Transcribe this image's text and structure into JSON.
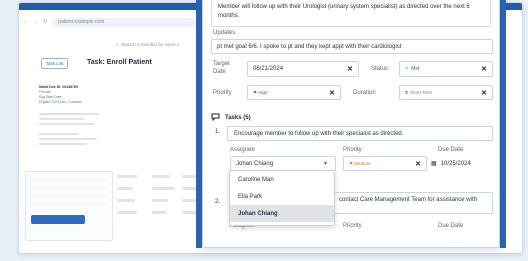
{
  "background": {
    "url_text": "patient.example.com",
    "search_placeholder": "Search a member by name o",
    "back_label": "Task List",
    "page_title": "Task: Enroll Patient",
    "member_info": [
      "Maria Doe ID: 00448765",
      "Female",
      "Elig Start Date",
      "Eligible 2024 Dec. Contract"
    ]
  },
  "panel": {
    "note_text": "Member will follow up with their Urologist (urinary system specialist) as directed over the next 6 months.",
    "updates_label": "Updates",
    "updates_value": "pt met goal 6/6. I spoke to pt and they kept appt with their cardiologist",
    "target_date_label": "Target Date",
    "target_date_value": "06/21/2024",
    "status_label": "Status",
    "status_value": "Met",
    "priority_label": "Priority",
    "priority_value": "High",
    "duration_label": "Duration",
    "duration_value": "Short Term",
    "tasks_heading": "Tasks (5)",
    "task1": {
      "number": "1.",
      "text": "Encourage member to follow up with their specialist as directed.",
      "assignee_label": "Assignee",
      "assignee_value": "Johan Chiang",
      "priority_label": "Priority",
      "priority_value": "Medium",
      "due_date_label": "Due Date",
      "due_date_value": "10/25/2024"
    },
    "dropdown_options": [
      "Caroline Man",
      "Ella Park",
      "Johan Chiang"
    ],
    "task2": {
      "number": "2.",
      "text_visible": "contact Care Management Team for assistance with",
      "assignee_label": "Assignee",
      "priority_label": "Priority",
      "due_date_label": "Due Date"
    }
  }
}
